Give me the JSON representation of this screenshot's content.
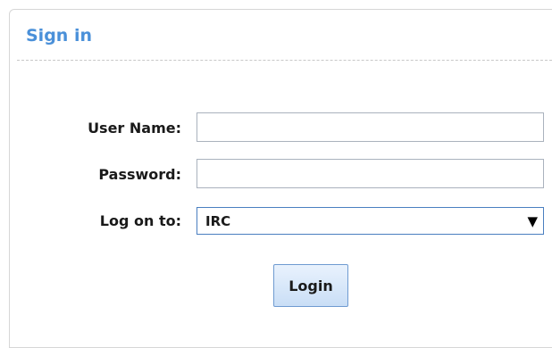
{
  "signin": {
    "title": "Sign in",
    "username_label": "User Name:",
    "username_value": "",
    "password_label": "Password:",
    "password_value": "",
    "logon_label": "Log on to:",
    "logon_selected": "IRC",
    "login_button": "Login"
  },
  "icons": {
    "dropdown": "chevron-down-icon"
  },
  "colors": {
    "title": "#4a90d9",
    "button_border": "#6f9bd1",
    "select_border": "#4a7fc0"
  }
}
